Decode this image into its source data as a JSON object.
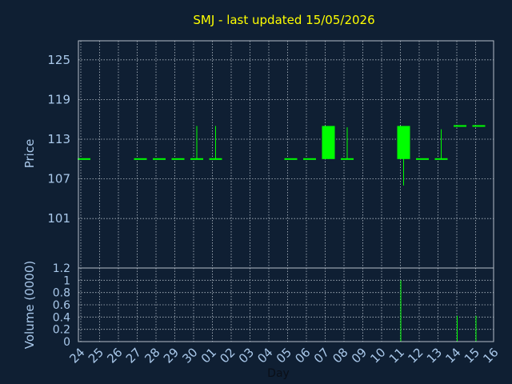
{
  "title": "SMJ - last updated 15/05/2026",
  "colors": {
    "background": "#0f1f33",
    "title": "#ffff00",
    "axis_text": "#a9c8ea",
    "candle": "#00ff00",
    "volume": "#00ff00",
    "grid": "#b4bec8",
    "frame": "#b4bec8"
  },
  "chart_data": [
    {
      "type": "candlestick",
      "ylabel": "Price",
      "ylim": [
        98,
        128
      ],
      "yticks": [
        "125",
        "119",
        "113",
        "107",
        "101"
      ],
      "grid": true,
      "x": [
        "24",
        "25",
        "26",
        "27",
        "28",
        "29",
        "30",
        "01",
        "02",
        "03",
        "04",
        "05",
        "06",
        "07",
        "08",
        "09",
        "10",
        "11",
        "12",
        "13",
        "14",
        "15",
        "16"
      ],
      "candles": [
        {
          "x": "24",
          "open": 110,
          "high": 110,
          "low": 110,
          "close": 110
        },
        {
          "x": "27",
          "open": 110,
          "high": 110,
          "low": 110,
          "close": 110
        },
        {
          "x": "28",
          "open": 110,
          "high": 110,
          "low": 110,
          "close": 110
        },
        {
          "x": "29",
          "open": 110,
          "high": 110,
          "low": 110,
          "close": 110
        },
        {
          "x": "30",
          "open": 110,
          "high": 115,
          "low": 110,
          "close": 110
        },
        {
          "x": "01",
          "open": 110,
          "high": 115,
          "low": 110,
          "close": 110
        },
        {
          "x": "05",
          "open": 110,
          "high": 110,
          "low": 110,
          "close": 110
        },
        {
          "x": "06",
          "open": 110,
          "high": 110,
          "low": 110,
          "close": 110
        },
        {
          "x": "07",
          "open": 110,
          "high": 115,
          "low": 110,
          "close": 115
        },
        {
          "x": "08",
          "open": 110,
          "high": 114.8,
          "low": 110,
          "close": 110
        },
        {
          "x": "11",
          "open": 115,
          "high": 115,
          "low": 106,
          "close": 110
        },
        {
          "x": "12",
          "open": 110,
          "high": 110,
          "low": 110,
          "close": 110
        },
        {
          "x": "13",
          "open": 110,
          "high": 114.5,
          "low": 110,
          "close": 110
        },
        {
          "x": "14",
          "open": 115,
          "high": 115,
          "low": 115,
          "close": 115
        },
        {
          "x": "15",
          "open": 115,
          "high": 115,
          "low": 115,
          "close": 115
        }
      ]
    },
    {
      "type": "bar",
      "ylabel": "Volume (0000)",
      "ylim": [
        0,
        1.2
      ],
      "yticks": [
        "1.2",
        "1",
        "0.8",
        "0.6",
        "0.4",
        "0.2",
        "0"
      ],
      "xlabel": "Day",
      "grid": true,
      "categories": [
        "11",
        "14",
        "15"
      ],
      "values": [
        1.0,
        0.42,
        0.42
      ]
    }
  ]
}
